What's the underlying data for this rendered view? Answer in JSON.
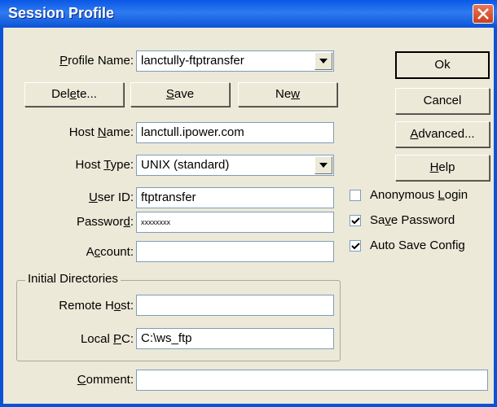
{
  "window": {
    "title": "Session Profile"
  },
  "form": {
    "profile_name": {
      "pre": "",
      "u": "P",
      "post": "rofile Name:",
      "value": "lanctully-ftptransfer"
    },
    "host_name": {
      "pre": "Host ",
      "u": "N",
      "post": "ame:",
      "value": "lanctull.ipower.com"
    },
    "host_type": {
      "pre": "Host ",
      "u": "T",
      "post": "ype:",
      "value": "UNIX (standard)"
    },
    "user_id": {
      "pre": "",
      "u": "U",
      "post": "ser ID:",
      "value": "ftptransfer"
    },
    "password": {
      "pre": "Passwor",
      "u": "d",
      "post": ":",
      "value": "xxxxxxxx"
    },
    "account": {
      "pre": "A",
      "u": "c",
      "post": "count:",
      "value": ""
    },
    "comment": {
      "pre": "",
      "u": "C",
      "post": "omment:",
      "value": ""
    }
  },
  "row_buttons": {
    "delete": {
      "pre": "Del",
      "u": "e",
      "post": "te..."
    },
    "save": {
      "pre": "",
      "u": "S",
      "post": "ave"
    },
    "new": {
      "pre": "Ne",
      "u": "w",
      "post": ""
    }
  },
  "side_buttons": {
    "ok": {
      "pre": "",
      "u": "",
      "post": "Ok"
    },
    "cancel": {
      "pre": "",
      "u": "",
      "post": "Cancel"
    },
    "advanced": {
      "pre": "",
      "u": "A",
      "post": "dvanced..."
    },
    "help": {
      "pre": "",
      "u": "H",
      "post": "elp"
    }
  },
  "options": {
    "anonymous": {
      "pre": "Anonymous ",
      "u": "L",
      "post": "ogin",
      "checked": false
    },
    "save_password": {
      "pre": "Sa",
      "u": "v",
      "post": "e Password",
      "checked": true
    },
    "auto_save": {
      "pre": "Auto Save Config",
      "u": "",
      "post": "",
      "checked": true
    }
  },
  "initial_dirs": {
    "legend": "Initial Directories",
    "remote_host": {
      "pre": "Remote H",
      "u": "o",
      "post": "st:",
      "value": ""
    },
    "local_pc": {
      "pre": "Local ",
      "u": "P",
      "post": "C:",
      "value": "C:\\ws_ftp"
    }
  }
}
